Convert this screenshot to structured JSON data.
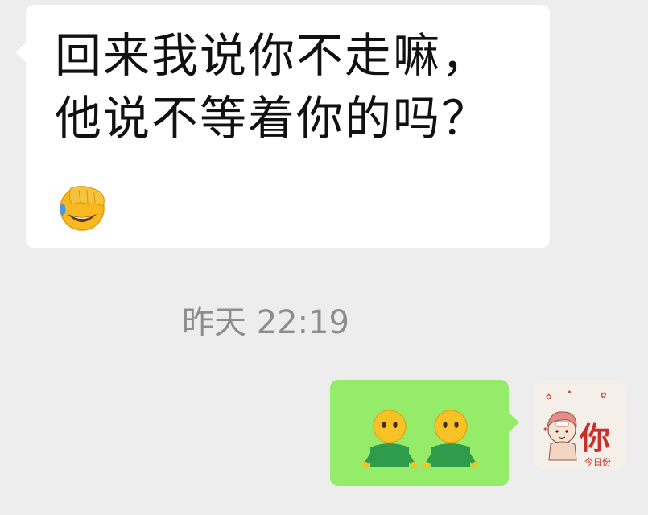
{
  "incoming_message": {
    "line1": "回来我说你不走嘛，",
    "line2": "他说不等着你的吗？",
    "emoji": "facepalm-laugh-icon"
  },
  "timestamp": "昨天 22:19",
  "outgoing_message": {
    "emojis": [
      "person-icon",
      "person-icon"
    ]
  },
  "avatar": {
    "title_char": "你",
    "caption": "今日份"
  },
  "colors": {
    "background": "#ededed",
    "incoming_bubble": "#ffffff",
    "outgoing_bubble": "#95ec69",
    "timestamp_text": "#8d8d8d"
  }
}
